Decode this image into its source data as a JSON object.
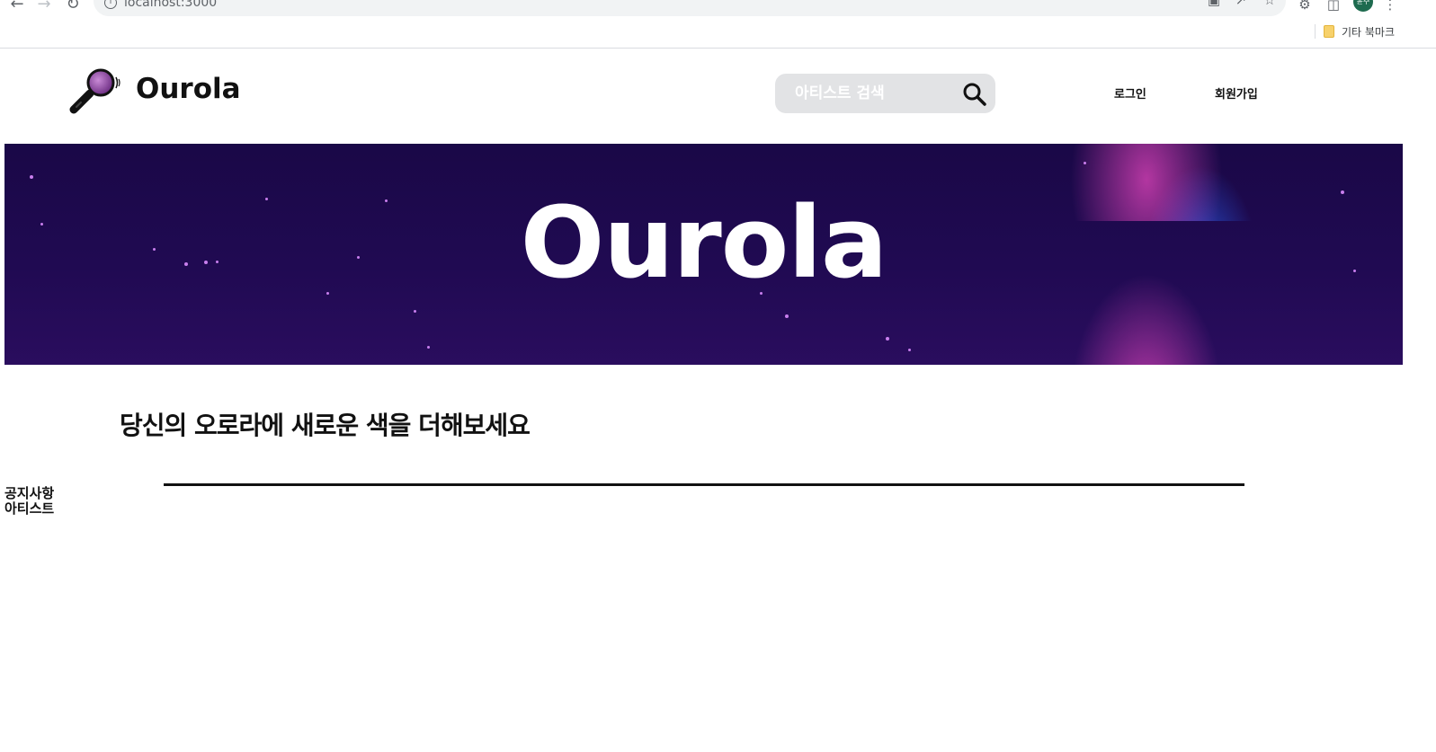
{
  "browser": {
    "url": "localhost:3000",
    "profile_initials": "윤주",
    "bookmark_label": "기타 북마크"
  },
  "header": {
    "logo_text": "Ourola",
    "search_placeholder": "아티스트 검색",
    "nav": {
      "login": "로그인",
      "signup": "회원가입"
    }
  },
  "hero": {
    "title": "Ourola"
  },
  "main": {
    "tagline": "당신의 오로라에 새로운 색을 더해보세요"
  },
  "side_menu": {
    "items": [
      "공지사항",
      "아티스트"
    ]
  },
  "colors": {
    "hero_bg": "#1a0847",
    "aurora_pink": "#e646be",
    "aurora_blue": "#285ae6",
    "search_bg": "#e2e3e5"
  }
}
